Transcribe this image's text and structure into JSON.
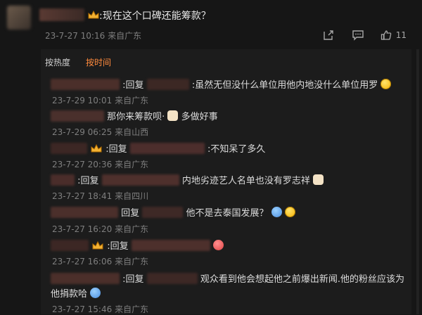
{
  "post": {
    "text": ":现在这个口碑还能筹款？",
    "time": "23-7-27 10:16",
    "source": "来自广东",
    "like_count": "11"
  },
  "sort": {
    "hot": "按热度",
    "time": "按时间"
  },
  "replies": [
    {
      "prefix": ":回复",
      "text": ":虽然无但没什么单位用他内地没什么单位用罗",
      "time": "23-7-29 10:01",
      "source": "来自广东"
    },
    {
      "prefix": "",
      "text": "那你来筹款呗·",
      "suffix": "多做好事",
      "time": "23-7-29 06:25",
      "source": "来自山西"
    },
    {
      "prefix": ":回复",
      "text": ":不知呆了多久",
      "time": "23-7-27 20:36",
      "source": "来自广东"
    },
    {
      "prefix": ":回复",
      "text": "内地劣迹艺人名单也没有罗志祥",
      "time": "23-7-27 18:41",
      "source": "来自四川"
    },
    {
      "prefix": "回复",
      "text": "他不是去泰国发展？",
      "time": "23-7-27 16:20",
      "source": "来自广东"
    },
    {
      "prefix": ":回复",
      "text": "",
      "time": "23-7-27 16:06",
      "source": "来自广东"
    },
    {
      "prefix": ":回复",
      "text": "观众看到他会想起他之前爆出新闻.他的粉丝应该为",
      "text2": "他捐款哈",
      "time": "23-7-27 15:46",
      "source": "来自广东"
    }
  ],
  "icons": {
    "share": "share-icon",
    "comment": "comment-icon",
    "like": "thumbs-up-icon",
    "crown": "crown-badge-icon",
    "emoji": "emoji-icon"
  }
}
